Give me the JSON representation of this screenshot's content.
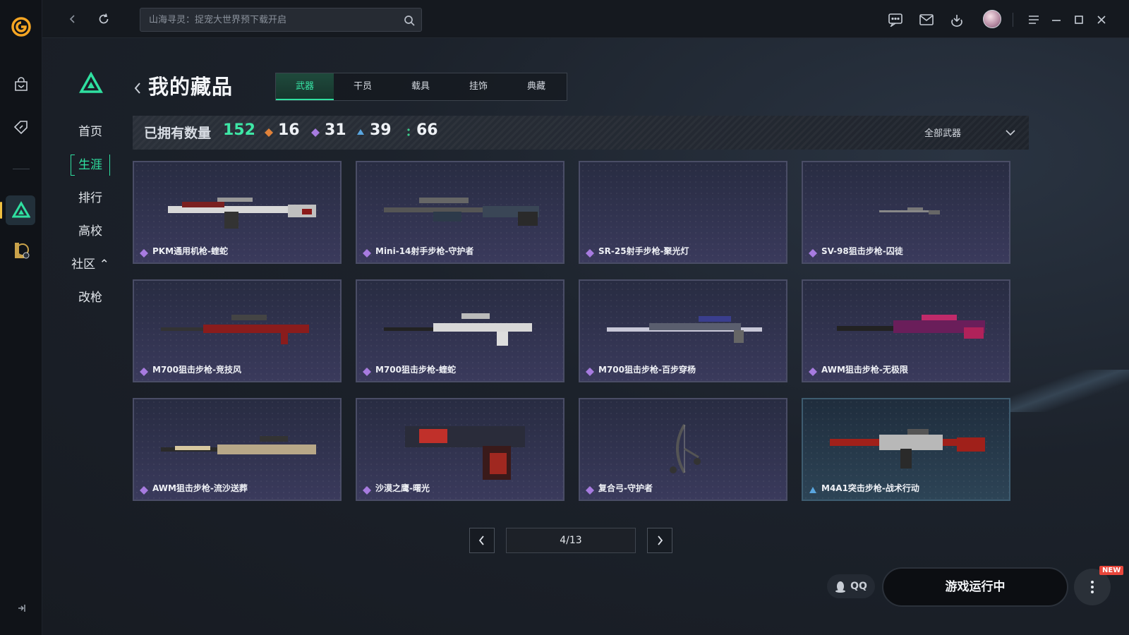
{
  "topbar": {
    "search_placeholder": "山海寻灵：捉宠大世界预下载开启"
  },
  "game_nav": {
    "items": [
      {
        "label": "首页"
      },
      {
        "label": "生涯"
      },
      {
        "label": "排行"
      },
      {
        "label": "高校"
      },
      {
        "label": "社区 ⌃"
      },
      {
        "label": "改枪"
      }
    ],
    "active_index": 1
  },
  "page": {
    "title": "我的藏品",
    "tabs": [
      {
        "label": "武器"
      },
      {
        "label": "干员"
      },
      {
        "label": "载具"
      },
      {
        "label": "挂饰"
      },
      {
        "label": "典藏"
      }
    ],
    "active_tab": 0
  },
  "summary": {
    "owned_label": "已拥有数量",
    "owned_total": "152",
    "rarity_counts": [
      {
        "value": "16",
        "color": "#e0823a",
        "icon": "orange-gem-icon"
      },
      {
        "value": "31",
        "color": "#a77be0",
        "icon": "purple-gem-icon"
      },
      {
        "value": "39",
        "color": "#5aa6e0",
        "icon": "blue-gem-icon"
      },
      {
        "value": "66",
        "color": "#3ecf8e",
        "icon": "green-gem-icon"
      }
    ],
    "filter_label": "全部武器"
  },
  "items": [
    {
      "name": "PKM通用机枪-蝰蛇",
      "rarity": "purple"
    },
    {
      "name": "Mini-14射手步枪-守护者",
      "rarity": "purple"
    },
    {
      "name": "SR-25射手步枪-聚光灯",
      "rarity": "purple"
    },
    {
      "name": "SV-98狙击步枪-囚徒",
      "rarity": "purple"
    },
    {
      "name": "M700狙击步枪-竞技风",
      "rarity": "purple"
    },
    {
      "name": "M700狙击步枪-蝰蛇",
      "rarity": "purple"
    },
    {
      "name": "M700狙击步枪-百步穿杨",
      "rarity": "purple"
    },
    {
      "name": "AWM狙击步枪-无极限",
      "rarity": "purple"
    },
    {
      "name": "AWM狙击步枪-流沙送葬",
      "rarity": "purple"
    },
    {
      "name": "沙漠之鹰-曙光",
      "rarity": "purple"
    },
    {
      "name": "复合弓-守护者",
      "rarity": "purple"
    },
    {
      "name": "M4A1突击步枪-战术行动",
      "rarity": "blue"
    }
  ],
  "pager": {
    "page_text": "4/13"
  },
  "footer": {
    "qq_label": "QQ",
    "launch_label": "游戏运行中",
    "new_badge": "NEW"
  }
}
